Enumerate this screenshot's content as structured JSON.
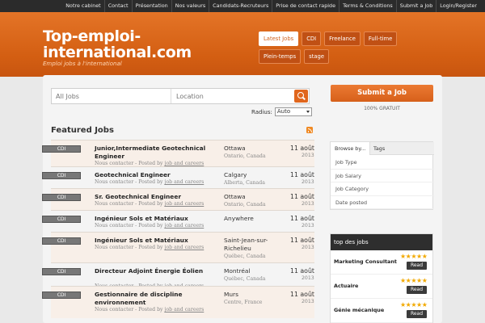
{
  "topnav": [
    "Notre cabinet",
    "Contact",
    "Présentation",
    "Nos valeurs",
    "Candidats-Recruteurs",
    "Prise de contact rapide",
    "Terms & Conditions",
    "Submit a Job",
    "Login/Register"
  ],
  "site": {
    "title": "Top-emploi-international.com",
    "tagline": "Emploi jobs à l'international"
  },
  "categories": [
    {
      "label": "Latest Jobs",
      "active": true
    },
    {
      "label": "CDI"
    },
    {
      "label": "Freelance"
    },
    {
      "label": "Full-time"
    },
    {
      "label": "Plein-temps"
    },
    {
      "label": "stage"
    }
  ],
  "search": {
    "keywords_placeholder": "All Jobs",
    "location_placeholder": "Location",
    "radius_label": "Radius:",
    "radius_value": "Auto"
  },
  "featured_title": "Featured Jobs",
  "jobs": [
    {
      "type": "CDI",
      "title": "Junior,Intermediate Geotechnical Engineer",
      "meta_prefix": "Nous contacter - Posted by",
      "meta_by": "job and careers",
      "location": "Ottawa",
      "region": "Ontario, Canada",
      "date": "11 août",
      "year": "2013"
    },
    {
      "type": "CDI",
      "title": "Geotechnical Engineer",
      "meta_prefix": "Nous contacter - Posted by",
      "meta_by": "job and careers",
      "location": "Calgary",
      "region": "Alberta, Canada",
      "date": "11 août",
      "year": "2013"
    },
    {
      "type": "CDI",
      "title": "Sr. Geotechnical Engineer",
      "meta_prefix": "Nous contacter - Posted by",
      "meta_by": "job and careers",
      "location": "Ottawa",
      "region": "Ontario, Canada",
      "date": "11 août",
      "year": "2013"
    },
    {
      "type": "CDI",
      "title": "Ingénieur Sols et Matériaux",
      "meta_prefix": "Nous contacter - Posted by",
      "meta_by": "job and careers",
      "location": "Anywhere",
      "region": "",
      "date": "11 août",
      "year": "2013"
    },
    {
      "type": "CDI",
      "title": "Ingénieur Sols et Matériaux",
      "meta_prefix": "Nous contacter - Posted by",
      "meta_by": "job and careers",
      "location": "Saint-Jean-sur-Richelieu",
      "region": "Québec, Canada",
      "date": "11 août",
      "year": "2013"
    },
    {
      "type": "CDI",
      "title": "Directeur Adjoint Énergie Éolien",
      "meta_prefix": "Nous contacter - Posted by",
      "meta_by": "job and careers",
      "location": "Montréal",
      "region": "Québec, Canada",
      "date": "11 août",
      "year": "2013"
    },
    {
      "type": "CDI",
      "title": "Gestionnaire de discipline environnement",
      "meta_prefix": "Nous contacter - Posted by",
      "meta_by": "job and careers",
      "location": "Murs",
      "region": "Centre, France",
      "date": "11 août",
      "year": "2013"
    }
  ],
  "sidebar": {
    "submit_label": "Submit a Job",
    "free_label": "100% GRATUIT",
    "tabs": [
      "Browse by...",
      "Tags"
    ],
    "browse": [
      "Job Type",
      "Job Salary",
      "Job Category",
      "Date posted"
    ],
    "top_title": "top des jobs",
    "top_jobs": [
      {
        "name": "Marketing Consultant",
        "stars": "★★★★★",
        "read": "Read"
      },
      {
        "name": "Actuaire",
        "stars": "★★★★★",
        "read": "Read"
      },
      {
        "name": "Génie mécanique",
        "stars": "★★★★★",
        "read": "Read"
      }
    ]
  }
}
